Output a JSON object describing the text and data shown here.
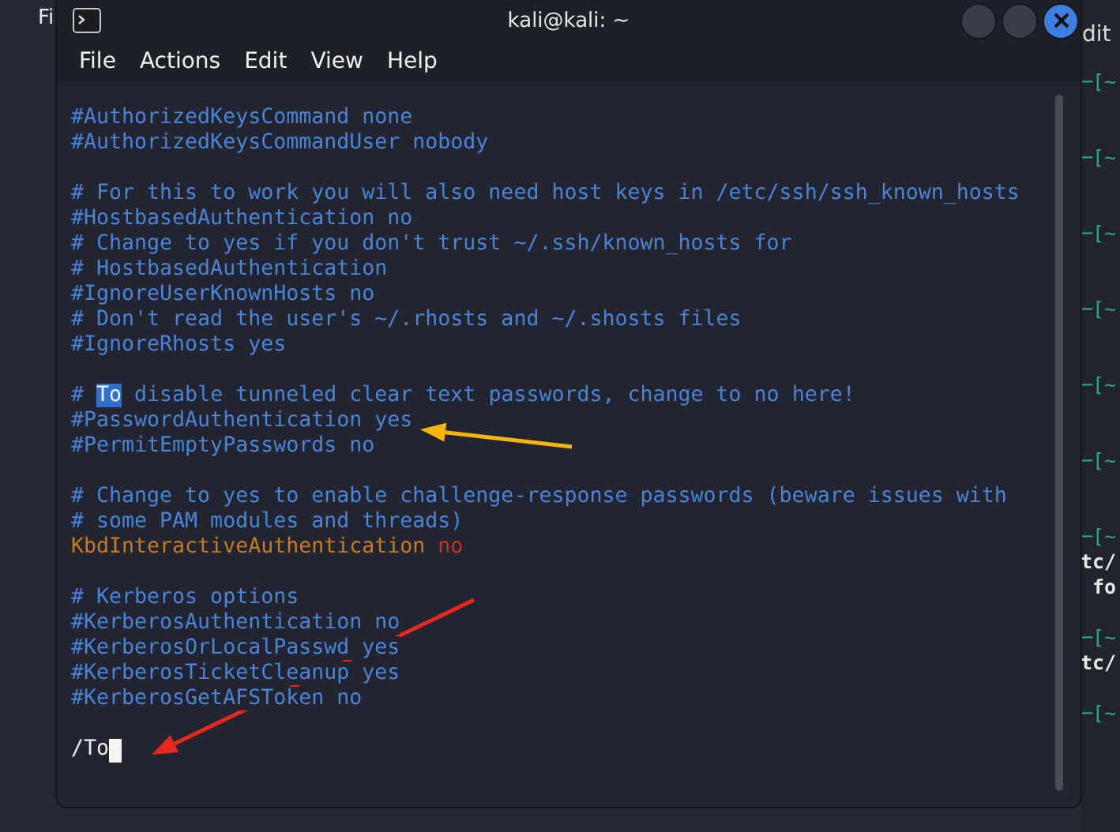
{
  "desktop": {
    "icon_label": "Fi"
  },
  "background_terminal": {
    "menu": [
      "dit"
    ],
    "rows": [
      {
        "kind": "prompt",
        "text": "─[~"
      },
      {
        "kind": "hidden"
      },
      {
        "kind": "hidden"
      },
      {
        "kind": "prompt",
        "text": "─[~"
      },
      {
        "kind": "hidden"
      },
      {
        "kind": "hidden"
      },
      {
        "kind": "prompt",
        "text": "─[~"
      },
      {
        "kind": "hidden"
      },
      {
        "kind": "hidden"
      },
      {
        "kind": "prompt",
        "text": "─[~"
      },
      {
        "kind": "hidden"
      },
      {
        "kind": "hidden"
      },
      {
        "kind": "prompt",
        "text": "─[~"
      },
      {
        "kind": "hidden"
      },
      {
        "kind": "hidden"
      },
      {
        "kind": "prompt",
        "text": "─[~"
      },
      {
        "kind": "hidden"
      },
      {
        "kind": "hidden"
      },
      {
        "kind": "prompt",
        "text": "─[~"
      },
      {
        "kind": "output",
        "text": "tc/"
      },
      {
        "kind": "output",
        "text": " fo"
      },
      {
        "kind": "hidden"
      },
      {
        "kind": "prompt",
        "text": "─[~"
      },
      {
        "kind": "output",
        "text": "tc/"
      },
      {
        "kind": "hidden"
      },
      {
        "kind": "prompt",
        "text": "─[~"
      }
    ]
  },
  "window": {
    "title": "kali@kali: ~"
  },
  "menu": [
    "File",
    "Actions",
    "Edit",
    "View",
    "Help"
  ],
  "editor": {
    "blocks": [
      {
        "lines": [
          [
            {
              "kind": "comment",
              "text": "#AuthorizedKeysCommand none"
            }
          ],
          [
            {
              "kind": "comment",
              "text": "#AuthorizedKeysCommandUser nobody"
            }
          ]
        ]
      },
      {
        "lines": [
          [
            {
              "kind": "comment",
              "text": "# For this to work you will also need host keys in /etc/ssh/ssh_known_hosts"
            }
          ],
          [
            {
              "kind": "comment",
              "text": "#HostbasedAuthentication no"
            }
          ],
          [
            {
              "kind": "comment",
              "text": "# Change to yes if you don't trust ~/.ssh/known_hosts for"
            }
          ],
          [
            {
              "kind": "comment",
              "text": "# HostbasedAuthentication"
            }
          ],
          [
            {
              "kind": "comment",
              "text": "#IgnoreUserKnownHosts no"
            }
          ],
          [
            {
              "kind": "comment",
              "text": "# Don't read the user's ~/.rhosts and ~/.shosts files"
            }
          ],
          [
            {
              "kind": "comment",
              "text": "#IgnoreRhosts yes"
            }
          ]
        ]
      },
      {
        "lines": [
          [
            {
              "kind": "comment",
              "text": "# "
            },
            {
              "kind": "match",
              "text": "To"
            },
            {
              "kind": "comment",
              "text": " disable tunneled clear text passwords, change to no here!"
            }
          ],
          [
            {
              "kind": "comment",
              "text": "#PasswordAuthentication yes"
            }
          ],
          [
            {
              "kind": "comment",
              "text": "#PermitEmptyPasswords no"
            }
          ]
        ]
      },
      {
        "lines": [
          [
            {
              "kind": "comment",
              "text": "# Change to yes to enable challenge-response passwords (beware issues with"
            }
          ],
          [
            {
              "kind": "comment",
              "text": "# some PAM modules and threads)"
            }
          ],
          [
            {
              "kind": "keyword",
              "text": "KbdInteractiveAuthentication "
            },
            {
              "kind": "value",
              "text": "no"
            }
          ]
        ]
      },
      {
        "lines": [
          [
            {
              "kind": "comment",
              "text": "# Kerberos options"
            }
          ],
          [
            {
              "kind": "comment",
              "text": "#KerberosAuthentication no"
            }
          ],
          [
            {
              "kind": "comment",
              "text": "#KerberosOrLocalPasswd yes"
            }
          ],
          [
            {
              "kind": "comment",
              "text": "#KerberosTicketCleanup yes"
            }
          ],
          [
            {
              "kind": "comment",
              "text": "#KerberosGetAFSToken no"
            }
          ]
        ]
      }
    ],
    "command_line": {
      "text": "/To",
      "cursor": true
    }
  },
  "annotations": [
    {
      "kind": "arrow",
      "color": "#f5b50c"
    },
    {
      "kind": "arrow",
      "color": "#e8281e"
    }
  ]
}
